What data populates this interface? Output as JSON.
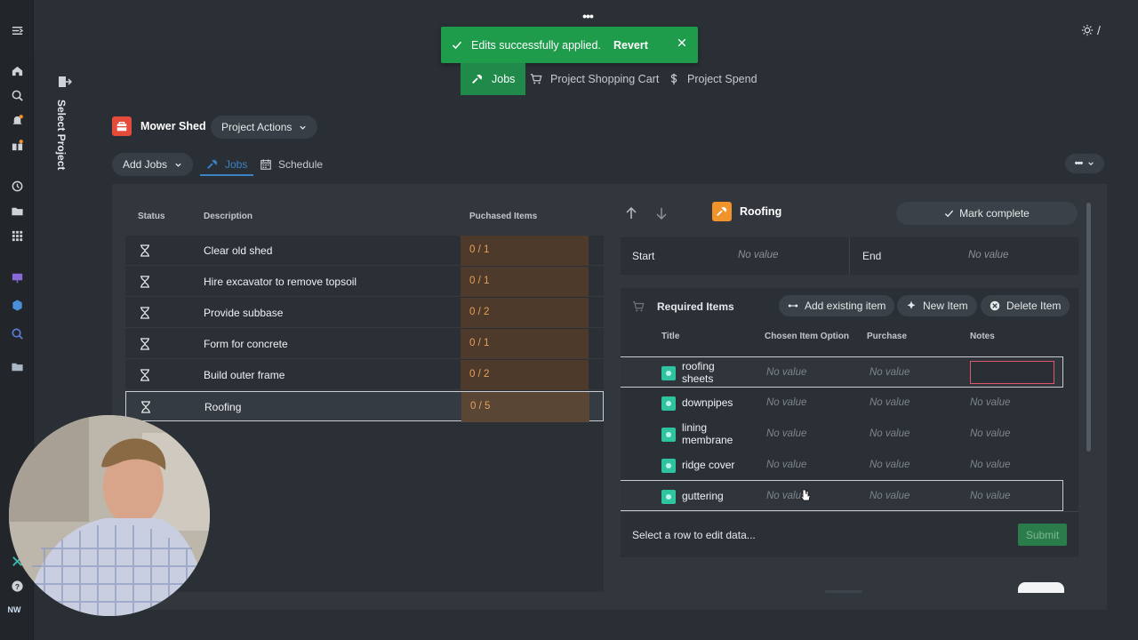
{
  "toast": {
    "message": "Edits successfully applied.",
    "action": "Revert"
  },
  "topbar": {
    "more": "•••",
    "theme_separator": "/"
  },
  "project_tabs": [
    {
      "label": "Jobs"
    },
    {
      "label": "Project Shopping Cart"
    },
    {
      "label": "Project Spend"
    }
  ],
  "sidebar": {
    "select_project": "Select Project",
    "user_initials": "NW"
  },
  "project": {
    "name": "Mower Shed",
    "actions_label": "Project Actions"
  },
  "subtabs": {
    "add_jobs": "Add Jobs",
    "jobs": "Jobs",
    "schedule": "Schedule",
    "more": "•••"
  },
  "jobs_table": {
    "columns": [
      "Status",
      "Description",
      "Puchased Items"
    ],
    "rows": [
      {
        "description": "Clear old shed",
        "purchased": "0 / 1"
      },
      {
        "description": "Hire excavator to remove topsoil",
        "purchased": "0 / 1"
      },
      {
        "description": "Provide subbase",
        "purchased": "0 / 2"
      },
      {
        "description": "Form for concrete",
        "purchased": "0 / 1"
      },
      {
        "description": "Build outer frame",
        "purchased": "0 / 2"
      },
      {
        "description": "Roofing",
        "purchased": "0 / 5"
      }
    ]
  },
  "job_detail": {
    "title": "Roofing",
    "mark_complete": "Mark complete",
    "start_label": "Start",
    "start_value": "No value",
    "end_label": "End",
    "end_value": "No value"
  },
  "required_items": {
    "title": "Required Items",
    "add_existing": "Add existing item",
    "new_item": "New Item",
    "delete_item": "Delete Item",
    "columns": [
      "Title",
      "Chosen Item Option",
      "Purchase",
      "Notes"
    ],
    "rows": [
      {
        "title": "roofing sheets",
        "option": "No value",
        "purchase": "No value",
        "notes": ""
      },
      {
        "title": "downpipes",
        "option": "No value",
        "purchase": "No value",
        "notes": "No value"
      },
      {
        "title": "lining membrane",
        "option": "No value",
        "purchase": "No value",
        "notes": "No value"
      },
      {
        "title": "ridge cover",
        "option": "No value",
        "purchase": "No value",
        "notes": "No value"
      },
      {
        "title": "guttering",
        "option": "No value",
        "purchase": "No value",
        "notes": "No value"
      }
    ],
    "footer_message": "Select a row to edit data...",
    "submit": "Submit"
  },
  "colors": {
    "accent_green": "#1f8a4a",
    "toast_green": "#1f9b4c",
    "project_red": "#e44b3b",
    "job_orange": "#f0932b",
    "item_teal": "#2ec4a0"
  }
}
